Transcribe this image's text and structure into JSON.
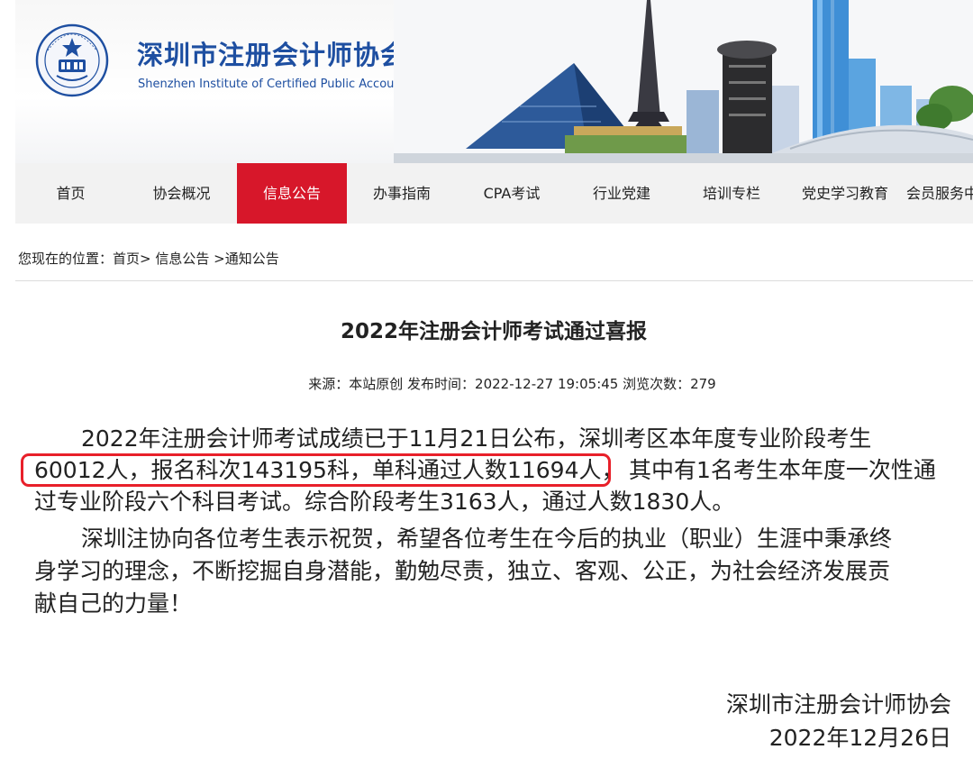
{
  "header": {
    "site_name": "深圳市注册会计师协会",
    "site_name_en": "Shenzhen Institute of Certified Public Accountants",
    "logo_icon": "institute-seal-icon",
    "brand_color": "#1e4fa1"
  },
  "nav": {
    "active_color": "#d7172a",
    "items": [
      {
        "label": "首页"
      },
      {
        "label": "协会概况"
      },
      {
        "label": "信息公告"
      },
      {
        "label": "办事指南"
      },
      {
        "label": "CPA考试"
      },
      {
        "label": "行业党建"
      },
      {
        "label": "培训专栏"
      },
      {
        "label": "党史学习教育"
      },
      {
        "label": "会员服务中"
      }
    ],
    "active_index": 2
  },
  "breadcrumb": {
    "prefix": "您现在的位置：",
    "items": [
      "首页>",
      "信息公告",
      ">通知公告"
    ]
  },
  "article": {
    "title": "2022年注册会计师考试通过喜报",
    "meta": "来源：本站原创 发布时间：2022-12-27 19:05:45   浏览次数：279",
    "lines": [
      "2022年注册会计师考试成绩已于11月21日公布，深圳考区本年度专业阶段考生",
      "60012人，报名科次143195科，单科通过人数11694人，",
      "其中有1名考生本年度一次性通",
      "过专业阶段六个科目考试。综合阶段考生3163人，通过人数1830人。",
      "深圳注协向各位考生表示祝贺，希望各位考生在今后的执业（职业）生涯中秉承终",
      "身学习的理念，不断挖掘自身潜能，勤勉尽责，独立、客观、公正，为社会经济发展贡",
      "献自己的力量！"
    ],
    "highlight_color": "#e8202a",
    "signature_org": "深圳市注册会计师协会",
    "signature_date": "2022年12月26日"
  }
}
